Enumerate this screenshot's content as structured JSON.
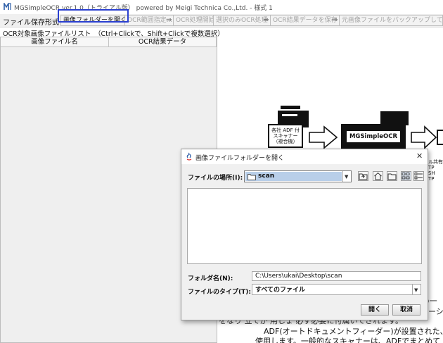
{
  "window": {
    "title": "MGSimpleOCR ver.1.0（トライアル版） powered by Meigi Technica Co.,Ltd. - 様式 1"
  },
  "menu": {
    "file": "ファイル",
    "save_format": "保存形式"
  },
  "toolbar": {
    "open_folder": "画像フォルダーを開く",
    "ocr_range": "OCR範囲指定...",
    "ocr_start": "OCR処理開始",
    "selected_only": "選択のみOCR処理",
    "save_results": "OCR結果データを保存",
    "backup_delete": "元画像ファイルをバックアップして削除",
    "arrow": "⇒"
  },
  "list": {
    "label": "OCR対象画像ファイルリスト　（Ctrl+Clickで、Shift+Clickで複数選択）",
    "columns": [
      "画像ファイル名",
      "OCR結果データ"
    ]
  },
  "diagram": {
    "scanner_label": [
      "各社 ADF 付",
      "スキャナー",
      "（複合機）"
    ],
    "app_label": "MGSimpleOCR",
    "share_text": [
      "ル共有",
      "TP",
      "SH",
      "TP"
    ],
    "para_line1": "))の一",
    "para_line2": "ーシ",
    "para_line3": "をなり 立てか 用しょ 必ず必要に付属いてされます。",
    "para_line4": "ADF(オートドキュメントフィーダー)が設置された、",
    "para_line5": "使用します。一般的なスキャナーは、ADFでまとめて"
  },
  "dialog": {
    "title": "画像ファイルフォルダーを開く",
    "location_label": "ファイルの場所(I):",
    "location_value": "scan",
    "folder_name_label": "フォルダ名(N):",
    "folder_name_value": "C:\\Users\\ukai\\Desktop\\scan",
    "file_type_label": "ファイルのタイプ(T):",
    "file_type_value": "すべてのファイル",
    "open_button": "開く",
    "cancel_button": "取消",
    "close_glyph": "✕"
  },
  "colors": {
    "highlight": "#2a3fd0",
    "accent": "#2e5fa8"
  }
}
